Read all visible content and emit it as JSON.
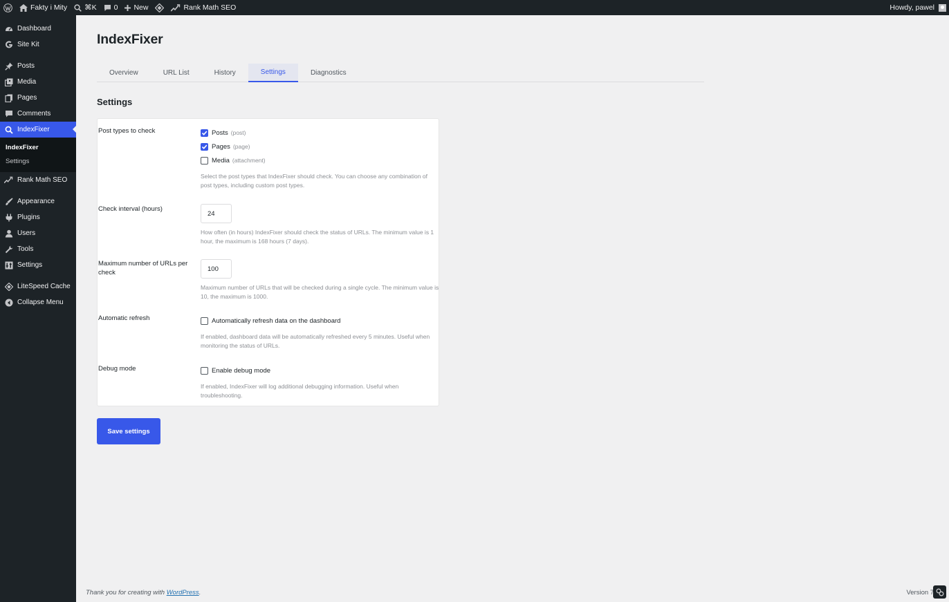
{
  "adminbar": {
    "site_name": "Fakty i Mity",
    "command_shortcut": "⌘K",
    "comments_count": "0",
    "new_label": "New",
    "rankmath_label": "Rank Math SEO",
    "howdy": "Howdy, pawel"
  },
  "sidebar": {
    "items": [
      {
        "label": "Dashboard",
        "icon": "dashboard-icon"
      },
      {
        "label": "Site Kit",
        "icon": "google-g-icon"
      },
      {
        "label": "Posts",
        "icon": "pin-icon"
      },
      {
        "label": "Media",
        "icon": "media-icon"
      },
      {
        "label": "Pages",
        "icon": "pages-icon"
      },
      {
        "label": "Comments",
        "icon": "comment-icon"
      },
      {
        "label": "IndexFixer",
        "icon": "search-icon"
      },
      {
        "label": "Rank Math SEO",
        "icon": "rankmath-icon"
      },
      {
        "label": "Appearance",
        "icon": "brush-icon"
      },
      {
        "label": "Plugins",
        "icon": "plugin-icon"
      },
      {
        "label": "Users",
        "icon": "user-icon"
      },
      {
        "label": "Tools",
        "icon": "wrench-icon"
      },
      {
        "label": "Settings",
        "icon": "settings-icon"
      },
      {
        "label": "LiteSpeed Cache",
        "icon": "litespeed-icon"
      },
      {
        "label": "Collapse Menu",
        "icon": "collapse-icon"
      }
    ],
    "submenu": [
      {
        "label": "IndexFixer"
      },
      {
        "label": "Settings"
      }
    ]
  },
  "page": {
    "title": "IndexFixer",
    "tabs": [
      "Overview",
      "URL List",
      "History",
      "Settings",
      "Diagnostics"
    ],
    "active_tab": "Settings",
    "section_title": "Settings"
  },
  "settings": {
    "post_types": {
      "label": "Post types to check",
      "options": [
        {
          "name": "Posts",
          "slug": "(post)",
          "checked": true
        },
        {
          "name": "Pages",
          "slug": "(page)",
          "checked": true
        },
        {
          "name": "Media",
          "slug": "(attachment)",
          "checked": false
        }
      ],
      "description": "Select the post types that IndexFixer should check. You can choose any combination of post types, including custom post types."
    },
    "check_interval": {
      "label": "Check interval (hours)",
      "value": "24",
      "description": "How often (in hours) IndexFixer should check the status of URLs. The minimum value is 1 hour, the maximum is 168 hours (7 days)."
    },
    "max_urls": {
      "label": "Maximum number of URLs per check",
      "value": "100",
      "description": "Maximum number of URLs that will be checked during a single cycle. The minimum value is 10, the maximum is 1000."
    },
    "auto_refresh": {
      "label": "Automatic refresh",
      "checkbox_label": "Automatically refresh data on the dashboard",
      "checked": false,
      "description": "If enabled, dashboard data will be automatically refreshed every 5 minutes. Useful when monitoring the status of URLs."
    },
    "debug": {
      "label": "Debug mode",
      "checkbox_label": "Enable debug mode",
      "checked": false,
      "description": "If enabled, IndexFixer will log additional debugging information. Useful when troubleshooting."
    },
    "save_label": "Save settings"
  },
  "footer": {
    "thanks_prefix": "Thank you for creating with ",
    "thanks_link": "WordPress",
    "thanks_suffix": ".",
    "version": "Version 7.0"
  },
  "colors": {
    "accent": "#3858e9",
    "adminbar_bg": "#1d2327",
    "page_bg": "#f0f0f1"
  }
}
